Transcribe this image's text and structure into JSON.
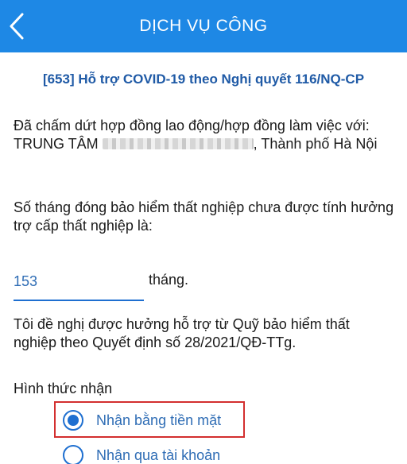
{
  "header": {
    "title": "DỊCH VỤ CÔNG",
    "back_icon": "chevron-left-icon"
  },
  "service": {
    "title": "[653] Hỗ trợ COVID-19 theo Nghị quyết 116/NQ-CP"
  },
  "contract": {
    "line_start": "Đã chấm dứt hợp đồng  lao động/hợp đồng làm việc với: TRUNG TÂM ",
    "line_end": ", Thành phố Hà Nội"
  },
  "unemployment": {
    "question": "Số tháng đóng bảo hiểm thất nghiệp chưa được tính hưởng trợ cấp thất nghiệp là:",
    "months_value": "153",
    "months_unit": "tháng."
  },
  "request": {
    "text": "Tôi đề nghị được hưởng hỗ trợ từ Quỹ bảo hiểm thất nghiệp theo Quyết định số 28/2021/QĐ-TTg."
  },
  "receive": {
    "label": "Hình thức nhận",
    "options": [
      {
        "label": "Nhận bằng tiền mặt",
        "selected": true
      },
      {
        "label": "Nhận qua tài khoản",
        "selected": false
      }
    ]
  },
  "colors": {
    "header_bg": "#1e88e5",
    "accent": "#1e6fd0",
    "title_text": "#1f5aa6",
    "highlight_border": "#d32f2f"
  }
}
